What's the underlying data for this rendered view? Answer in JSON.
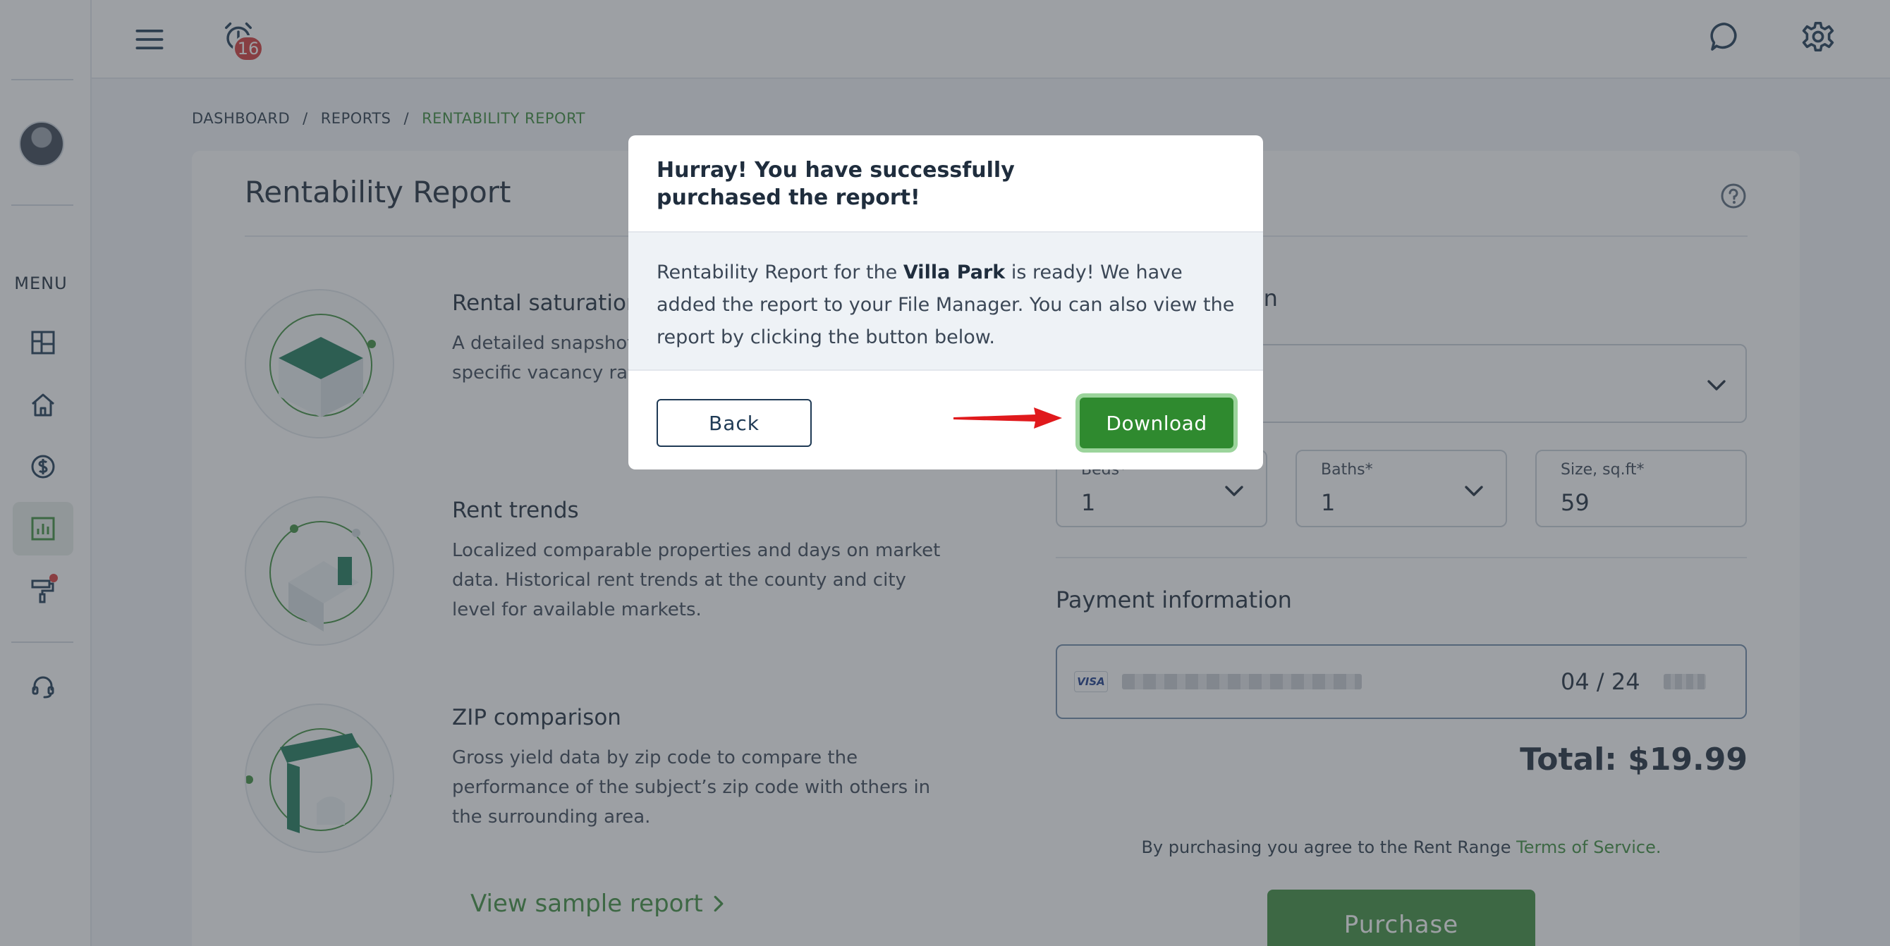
{
  "topbar": {
    "notifications_count": "16"
  },
  "sidebar": {
    "menu_label": "MENU"
  },
  "breadcrumb": {
    "items": [
      "DASHBOARD",
      "REPORTS",
      "RENTABILITY REPORT"
    ],
    "separator": "/"
  },
  "page": {
    "title": "Rentability Report"
  },
  "features": [
    {
      "title": "Rental saturation",
      "description": "A detailed snapshot of the current vacancy rate specific vacancy rates and benchmarks in the area."
    },
    {
      "title": "Rent trends",
      "description": "Localized comparable properties and days on market data. Historical rent trends at the county and city level for available markets."
    },
    {
      "title": "ZIP comparison",
      "description": "Gross yield data by zip code to compare the performance of the subject’s zip code with others in the surrounding area."
    }
  ],
  "sample_link": "View sample report",
  "form": {
    "heading_fragment": "on",
    "beds": {
      "label": "Beds*",
      "value": "1"
    },
    "baths": {
      "label": "Baths*",
      "value": "1"
    },
    "size": {
      "label": "Size, sq.ft*",
      "value": "59"
    }
  },
  "payment": {
    "heading": "Payment information",
    "card_brand": "VISA",
    "expiry": "04 / 24",
    "total": "Total: $19.99",
    "terms_prefix": "By purchasing you agree to the Rent Range ",
    "terms_link": "Terms of Service.",
    "purchase_label": "Purchase"
  },
  "modal": {
    "title": "Hurray! You have successfully purchased the report!",
    "body_prefix": "Rentability Report for the ",
    "body_bold": "Villa Park",
    "body_suffix": " is ready! We have added the report to your File Manager. You can also view the report by clicking the button below.",
    "back_label": "Back",
    "download_label": "Download"
  },
  "colors": {
    "brand_green": "#3f8f3f",
    "download_green": "#2f8a2f",
    "badge_red": "#d23b3b",
    "arrow_red": "#e0191c"
  }
}
